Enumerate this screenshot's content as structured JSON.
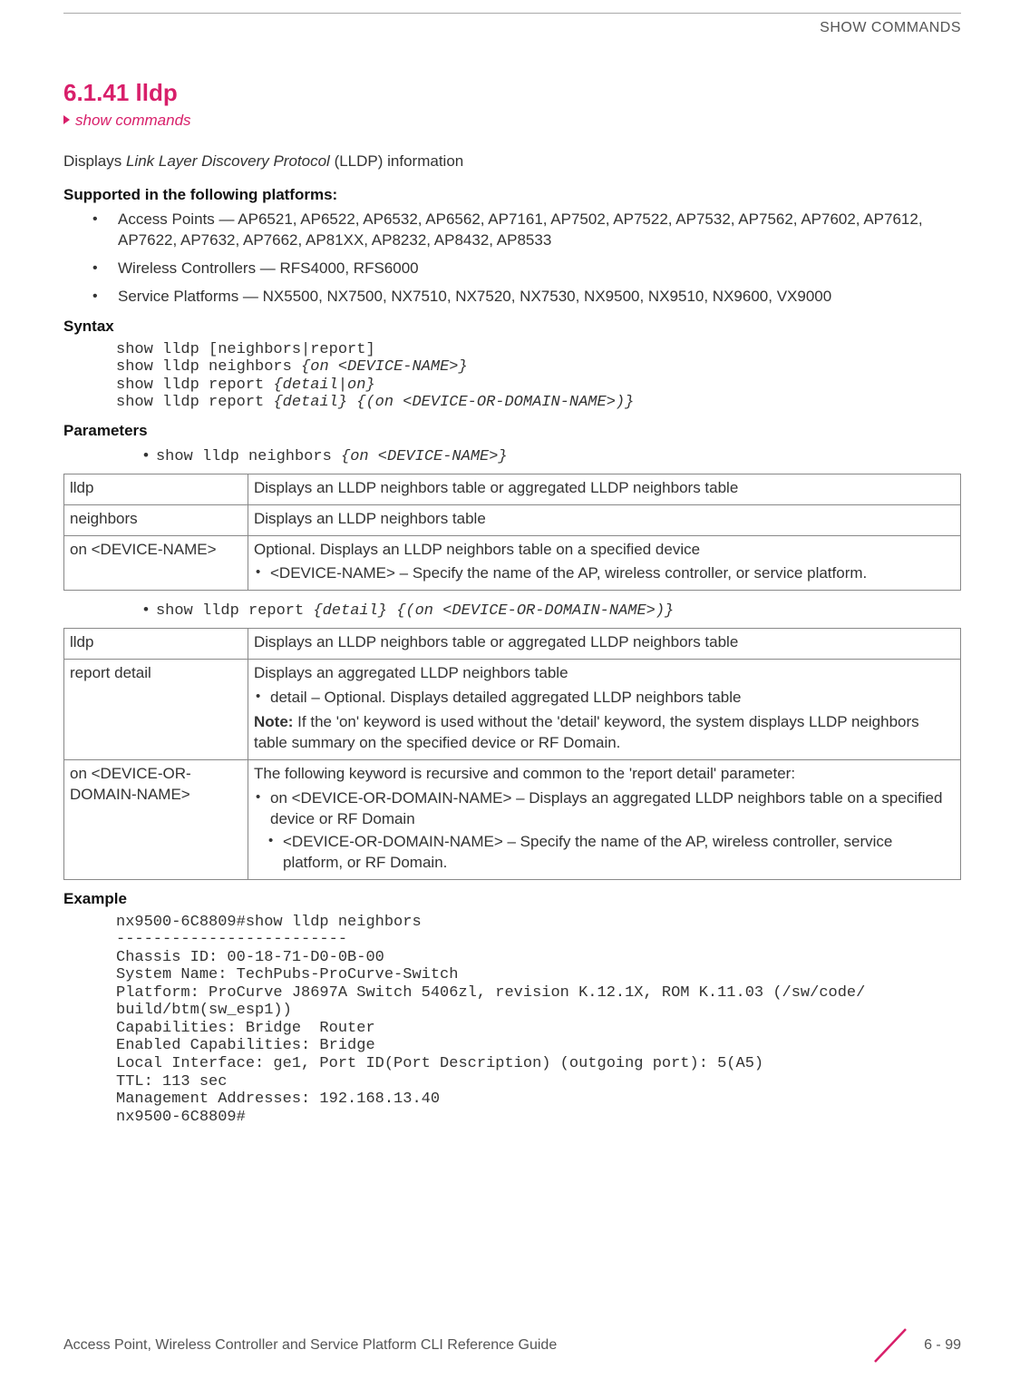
{
  "header": "SHOW COMMANDS",
  "section_number": "6.1.41 lldp",
  "breadcrumb": "show commands",
  "intro_pre": "Displays ",
  "intro_ital": "Link Layer Discovery Protocol",
  "intro_post": " (LLDP) information",
  "supported_heading": "Supported in the following platforms:",
  "platforms": {
    "ap": "Access Points — AP6521, AP6522, AP6532, AP6562, AP7161, AP7502, AP7522, AP7532, AP7562, AP7602, AP7612, AP7622, AP7632, AP7662, AP81XX, AP8232, AP8432, AP8533",
    "wc": "Wireless Controllers — RFS4000, RFS6000",
    "sp": "Service Platforms — NX5500, NX7500, NX7510, NX7520, NX7530, NX9500, NX9510, NX9600, VX9000"
  },
  "syntax_heading": "Syntax",
  "syntax": {
    "l1": "show lldp [neighbors|report]",
    "l2a": "show lldp neighbors ",
    "l2b": "{on <DEVICE-NAME>}",
    "l3a": "show lldp report ",
    "l3b": "{detail|on}",
    "l4a": "show lldp report ",
    "l4b": "{detail} {(on <DEVICE-OR-DOMAIN-NAME>)}"
  },
  "params_heading": "Parameters",
  "param1_cmd_a": "show lldp neighbors ",
  "param1_cmd_b": "{on <DEVICE-NAME>}",
  "table1": {
    "r1c1": "lldp",
    "r1c2": "Displays an LLDP neighbors table or aggregated LLDP neighbors table",
    "r2c1": "neighbors",
    "r2c2": "Displays an LLDP neighbors table",
    "r3c1": "on <DEVICE-NAME>",
    "r3c2_main": "Optional. Displays an LLDP neighbors table on a specified device",
    "r3c2_sub": "<DEVICE-NAME> – Specify the name of the AP, wireless controller, or service platform."
  },
  "param2_cmd_a": "show lldp report ",
  "param2_cmd_b": "{detail} {(on <DEVICE-OR-DOMAIN-NAME>)}",
  "table2": {
    "r1c1": "lldp",
    "r1c2": "Displays an LLDP neighbors table or aggregated LLDP neighbors table",
    "r2c1": "report detail",
    "r2c2_main": "Displays an aggregated LLDP neighbors table",
    "r2c2_sub": "detail – Optional. Displays detailed aggregated LLDP neighbors table",
    "r2c2_note_label": "Note:",
    "r2c2_note": " If the 'on' keyword is used without the 'detail' keyword, the system displays LLDP neighbors table summary on the specified device or RF Domain.",
    "r3c1": "on <DEVICE-OR-DOMAIN-NAME>",
    "r3c2_main": "The following keyword is recursive and common to the 'report detail' parameter:",
    "r3c2_sub": "on <DEVICE-OR-DOMAIN-NAME> – Displays an aggregated LLDP neighbors table on a specified device or RF Domain",
    "r3c2_subsub": "<DEVICE-OR-DOMAIN-NAME> – Specify the name of the AP, wireless controller, service platform, or RF Domain."
  },
  "example_heading": "Example",
  "example": "nx9500-6C8809#show lldp neighbors\n-------------------------\nChassis ID: 00-18-71-D0-0B-00\nSystem Name: TechPubs-ProCurve-Switch\nPlatform: ProCurve J8697A Switch 5406zl, revision K.12.1X, ROM K.11.03 (/sw/code/\nbuild/btm(sw_esp1))\nCapabilities: Bridge  Router\nEnabled Capabilities: Bridge\nLocal Interface: ge1, Port ID(Port Description) (outgoing port): 5(A5)\nTTL: 113 sec\nManagement Addresses: 192.168.13.40\nnx9500-6C8809#",
  "footer_left": "Access Point, Wireless Controller and Service Platform CLI Reference Guide",
  "footer_right": "6 - 99"
}
